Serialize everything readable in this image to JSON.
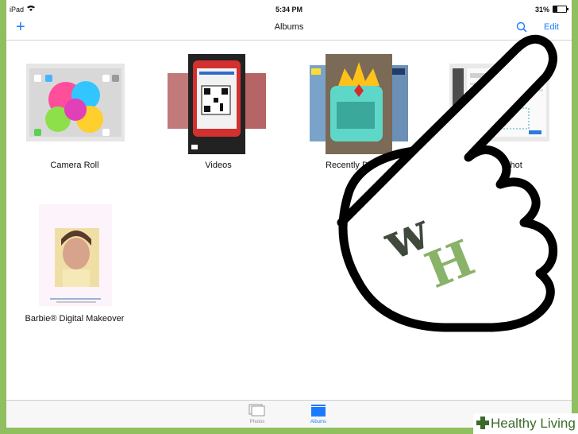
{
  "status_bar": {
    "carrier": "iPad",
    "time": "5:34 PM",
    "battery": "31%",
    "battery_level": 0.31
  },
  "nav_bar": {
    "title": "Albums",
    "add_icon": "plus-icon",
    "search_icon": "search-icon",
    "edit_label": "Edit"
  },
  "albums": [
    {
      "name": "Camera Roll"
    },
    {
      "name": "Videos"
    },
    {
      "name": "Recently Deleted"
    },
    {
      "name": "Screenshot"
    },
    {
      "name": "Barbie® Digital Makeover"
    }
  ],
  "tab_bar": {
    "items": [
      {
        "label": "Photos",
        "icon": "photos-icon",
        "selected": false
      },
      {
        "label": "Albums",
        "icon": "albums-icon",
        "selected": true
      }
    ]
  },
  "overlay": {
    "hand_logo_letters": "wH",
    "watermark": "Healthy Living"
  },
  "colors": {
    "accent": "#1a7bff",
    "frame": "#8fbf5e",
    "logo_dark": "#3f4a3c",
    "logo_green": "#8ab36a"
  }
}
